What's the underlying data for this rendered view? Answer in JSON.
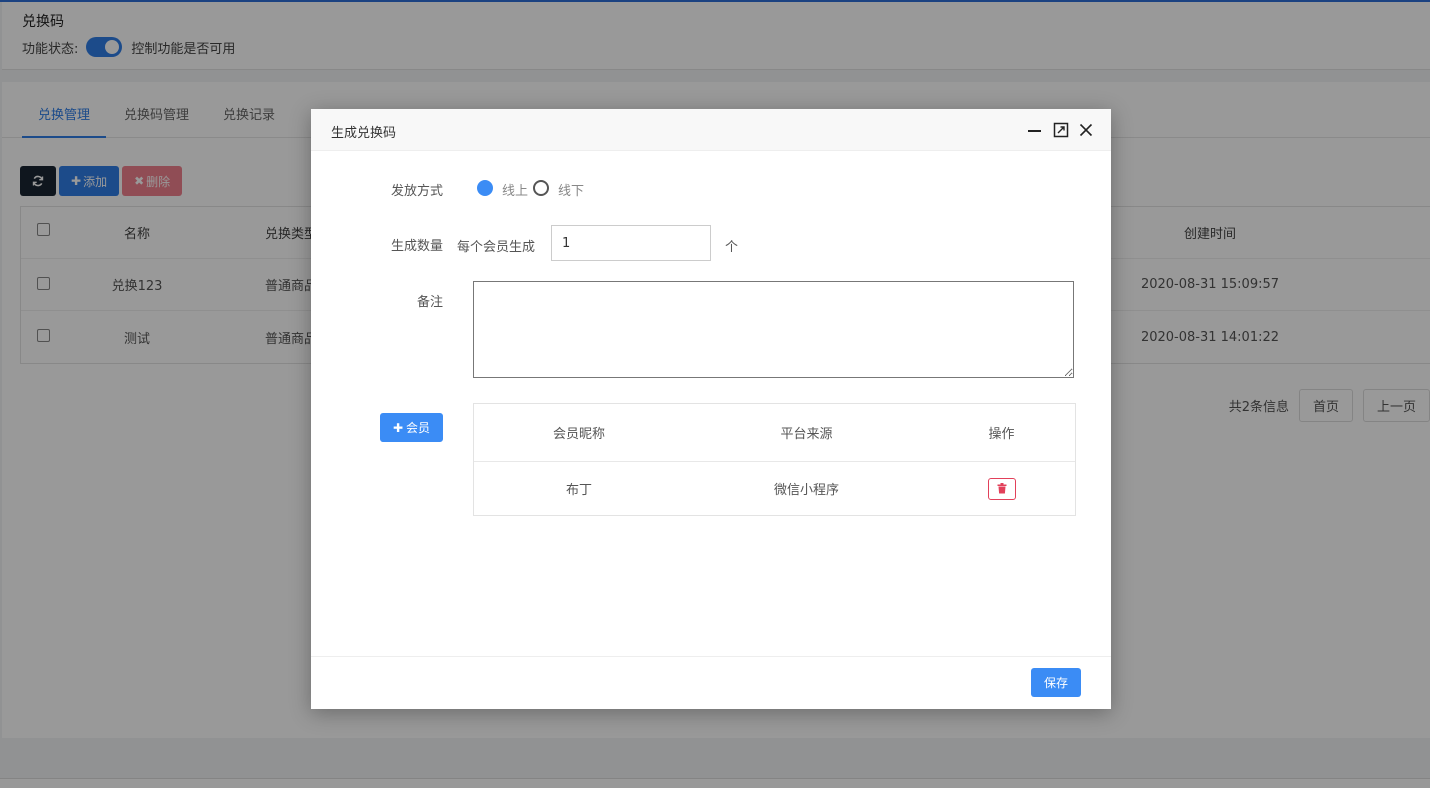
{
  "page": {
    "title": "兑换码",
    "status_label": "功能状态:",
    "status_hint": "控制功能是否可用"
  },
  "tabs": [
    {
      "label": "兑换管理",
      "active": true
    },
    {
      "label": "兑换码管理",
      "active": false
    },
    {
      "label": "兑换记录",
      "active": false
    }
  ],
  "toolbar": {
    "add_label": "添加",
    "delete_label": "删除"
  },
  "table": {
    "columns": {
      "name": "名称",
      "type": "兑换类型",
      "created": "创建时间"
    },
    "rows": [
      {
        "name": "兑换123",
        "type": "普通商品",
        "created": "2020-08-31 15:09:57"
      },
      {
        "name": "测试",
        "type": "普通商品",
        "created": "2020-08-31 14:01:22"
      }
    ]
  },
  "pager": {
    "total": "共2条信息",
    "first": "首页",
    "prev": "上一页"
  },
  "modal": {
    "title": "生成兑换码",
    "issue_label": "发放方式",
    "issue_online": "线上",
    "issue_offline": "线下",
    "qty_label": "生成数量",
    "qty_prefix": "每个会员生成",
    "qty_value": "1",
    "qty_unit": "个",
    "note_label": "备注",
    "note_value": "",
    "member_btn": "会员",
    "member_table": {
      "columns": {
        "nickname": "会员昵称",
        "platform": "平台来源",
        "action": "操作"
      },
      "rows": [
        {
          "nickname": "布丁",
          "platform": "微信小程序"
        }
      ]
    },
    "save_label": "保存"
  },
  "colors": {
    "primary": "#3b8cf5",
    "danger": "#e2405a"
  }
}
